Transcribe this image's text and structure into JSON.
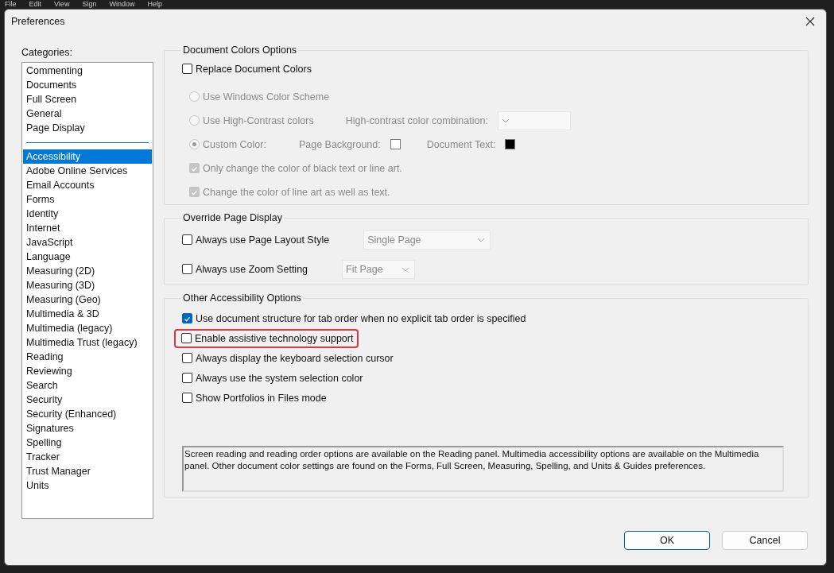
{
  "menu_bar": [
    "File",
    "Edit",
    "View",
    "Sign",
    "Window",
    "Help"
  ],
  "window": {
    "title": "Preferences"
  },
  "categories": {
    "label": "Categories:",
    "groups": [
      {
        "items": [
          {
            "label": "Commenting",
            "selected": false
          },
          {
            "label": "Documents",
            "selected": false
          },
          {
            "label": "Full Screen",
            "selected": false
          },
          {
            "label": "General",
            "selected": false
          },
          {
            "label": "Page Display",
            "selected": false
          }
        ]
      },
      {
        "items": [
          {
            "label": "Accessibility",
            "selected": true
          },
          {
            "label": "Adobe Online Services",
            "selected": false
          },
          {
            "label": "Email Accounts",
            "selected": false
          },
          {
            "label": "Forms",
            "selected": false
          },
          {
            "label": "Identity",
            "selected": false
          },
          {
            "label": "Internet",
            "selected": false
          },
          {
            "label": "JavaScript",
            "selected": false
          },
          {
            "label": "Language",
            "selected": false
          },
          {
            "label": "Measuring (2D)",
            "selected": false
          },
          {
            "label": "Measuring (3D)",
            "selected": false
          },
          {
            "label": "Measuring (Geo)",
            "selected": false
          },
          {
            "label": "Multimedia & 3D",
            "selected": false
          },
          {
            "label": "Multimedia (legacy)",
            "selected": false
          },
          {
            "label": "Multimedia Trust (legacy)",
            "selected": false
          },
          {
            "label": "Reading",
            "selected": false
          },
          {
            "label": "Reviewing",
            "selected": false
          },
          {
            "label": "Search",
            "selected": false
          },
          {
            "label": "Security",
            "selected": false
          },
          {
            "label": "Security (Enhanced)",
            "selected": false
          },
          {
            "label": "Signatures",
            "selected": false
          },
          {
            "label": "Spelling",
            "selected": false
          },
          {
            "label": "Tracker",
            "selected": false
          },
          {
            "label": "Trust Manager",
            "selected": false
          },
          {
            "label": "Units",
            "selected": false
          }
        ]
      }
    ]
  },
  "sections": [
    {
      "title": "Document Colors Options",
      "rows": [
        {
          "kind": "checkbox",
          "label": "Replace Document Colors",
          "checked": false,
          "disabled": false,
          "children": [
            {
              "kind": "radio",
              "label": "Use Windows Color Scheme",
              "selected": false,
              "disabled": true
            },
            {
              "kind": "radio",
              "label": "Use High-Contrast colors",
              "selected": false,
              "disabled": true,
              "dropdown": {
                "label": "High-contrast color combination:",
                "disabled": true
              }
            },
            {
              "kind": "radio",
              "label": "Custom Color:",
              "selected": true,
              "disabled": true,
              "swatches": [
                {
                  "label": "Page Background:",
                  "color": "#ffffff"
                },
                {
                  "label": "Document Text:",
                  "color": "#000000"
                }
              ]
            },
            {
              "kind": "checkbox",
              "label": "Only change the color of black text or line art.",
              "checked": true,
              "disabled": true
            },
            {
              "kind": "checkbox",
              "label": "Change the color of line art as well as text.",
              "checked": true,
              "disabled": true
            }
          ]
        }
      ]
    },
    {
      "title": "Override Page Display",
      "rows": [
        {
          "kind": "checkbox",
          "label": "Always use Page Layout Style",
          "checked": false,
          "disabled": false,
          "dropdown": {
            "value": "Single Page",
            "disabled": true
          }
        },
        {
          "kind": "checkbox",
          "label": "Always use Zoom Setting",
          "checked": false,
          "disabled": false,
          "dropdown": {
            "value": "Fit Page",
            "disabled": true
          }
        }
      ]
    },
    {
      "title": "Other Accessibility Options",
      "rows": [
        {
          "kind": "checkbox",
          "label": "Use document structure for tab order when no explicit tab order is specified",
          "checked": true,
          "disabled": false
        },
        {
          "kind": "checkbox",
          "label": "Enable assistive technology support",
          "checked": false,
          "disabled": false,
          "highlighted": true
        },
        {
          "kind": "checkbox",
          "label": "Always display the keyboard selection cursor",
          "checked": false,
          "disabled": false
        },
        {
          "kind": "checkbox",
          "label": "Always use the system selection color",
          "checked": false,
          "disabled": false
        },
        {
          "kind": "checkbox",
          "label": "Show Portfolios in Files mode",
          "checked": false,
          "disabled": false
        }
      ],
      "note": "Screen reading and reading order options are available on the Reading panel. Multimedia accessibility options are available on the Multimedia panel. Other document color settings are found on the Forms, Full Screen, Measuring, Spelling, and Units & Guides preferences."
    }
  ],
  "buttons": [
    {
      "label": "OK",
      "default": true
    },
    {
      "label": "Cancel",
      "default": false
    }
  ]
}
